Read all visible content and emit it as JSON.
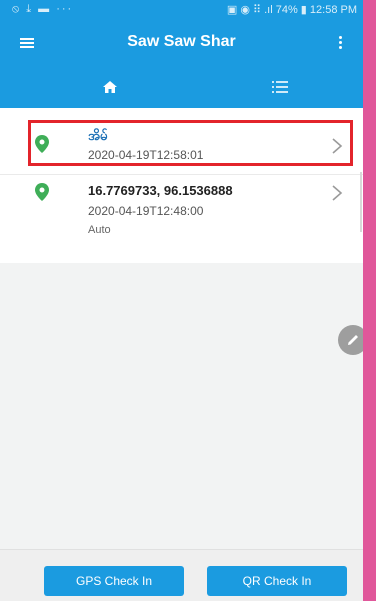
{
  "status_bar": {
    "left_icons": "⦸ ⤓ ▬ ···",
    "right_text": "▣ ◉ ⠿ .ıl 74% ▮ 12:58 PM"
  },
  "app_bar": {
    "title": "Saw Saw Shar",
    "menu_icon": "hamburger-menu-icon",
    "overflow_icon": "more-vert-icon"
  },
  "tabs": [
    {
      "icon": "home-icon",
      "selected": true
    },
    {
      "icon": "list-icon",
      "selected": false
    }
  ],
  "checkins": [
    {
      "title": "အိမ်",
      "timestamp": "2020-04-19T12:58:01",
      "note": ""
    },
    {
      "title": "16.7769733, 96.1536888",
      "timestamp": "2020-04-19T12:48:00",
      "note": "Auto"
    }
  ],
  "buttons": {
    "gps_check_in": "GPS Check In",
    "qr_check_in": "QR Check In"
  },
  "colors": {
    "primary": "#1b9be0",
    "pin": "#3fae58",
    "highlight": "#e3242b",
    "frame": "#e0579a"
  }
}
